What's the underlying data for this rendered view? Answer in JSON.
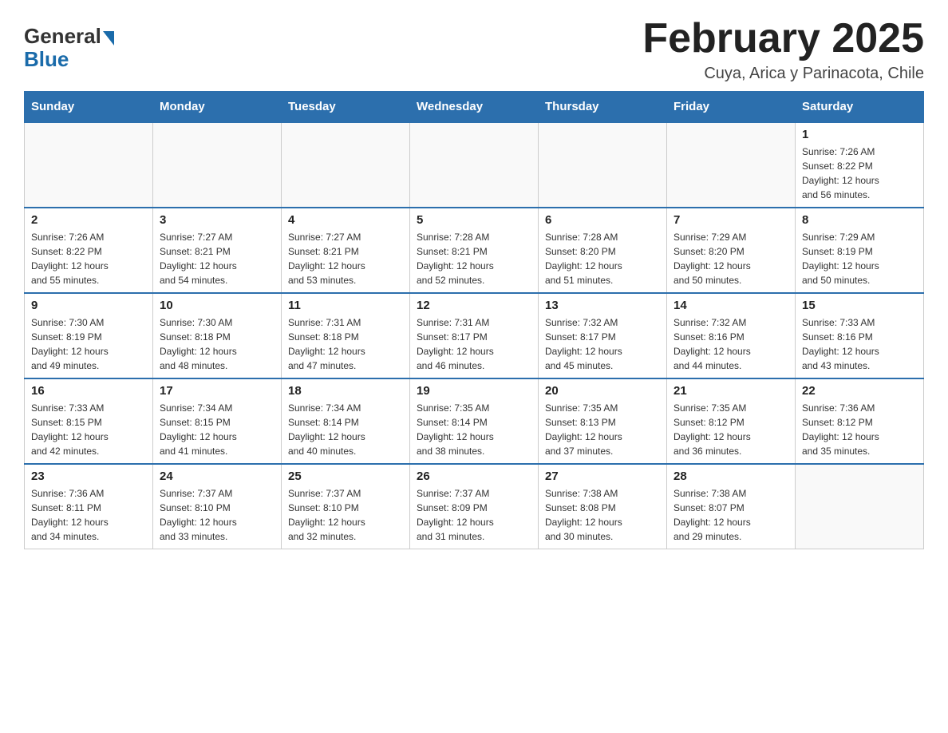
{
  "logo": {
    "general": "General",
    "blue": "Blue"
  },
  "title": "February 2025",
  "subtitle": "Cuya, Arica y Parinacota, Chile",
  "days_header": [
    "Sunday",
    "Monday",
    "Tuesday",
    "Wednesday",
    "Thursday",
    "Friday",
    "Saturday"
  ],
  "weeks": [
    [
      {
        "day": "",
        "info": ""
      },
      {
        "day": "",
        "info": ""
      },
      {
        "day": "",
        "info": ""
      },
      {
        "day": "",
        "info": ""
      },
      {
        "day": "",
        "info": ""
      },
      {
        "day": "",
        "info": ""
      },
      {
        "day": "1",
        "info": "Sunrise: 7:26 AM\nSunset: 8:22 PM\nDaylight: 12 hours\nand 56 minutes."
      }
    ],
    [
      {
        "day": "2",
        "info": "Sunrise: 7:26 AM\nSunset: 8:22 PM\nDaylight: 12 hours\nand 55 minutes."
      },
      {
        "day": "3",
        "info": "Sunrise: 7:27 AM\nSunset: 8:21 PM\nDaylight: 12 hours\nand 54 minutes."
      },
      {
        "day": "4",
        "info": "Sunrise: 7:27 AM\nSunset: 8:21 PM\nDaylight: 12 hours\nand 53 minutes."
      },
      {
        "day": "5",
        "info": "Sunrise: 7:28 AM\nSunset: 8:21 PM\nDaylight: 12 hours\nand 52 minutes."
      },
      {
        "day": "6",
        "info": "Sunrise: 7:28 AM\nSunset: 8:20 PM\nDaylight: 12 hours\nand 51 minutes."
      },
      {
        "day": "7",
        "info": "Sunrise: 7:29 AM\nSunset: 8:20 PM\nDaylight: 12 hours\nand 50 minutes."
      },
      {
        "day": "8",
        "info": "Sunrise: 7:29 AM\nSunset: 8:19 PM\nDaylight: 12 hours\nand 50 minutes."
      }
    ],
    [
      {
        "day": "9",
        "info": "Sunrise: 7:30 AM\nSunset: 8:19 PM\nDaylight: 12 hours\nand 49 minutes."
      },
      {
        "day": "10",
        "info": "Sunrise: 7:30 AM\nSunset: 8:18 PM\nDaylight: 12 hours\nand 48 minutes."
      },
      {
        "day": "11",
        "info": "Sunrise: 7:31 AM\nSunset: 8:18 PM\nDaylight: 12 hours\nand 47 minutes."
      },
      {
        "day": "12",
        "info": "Sunrise: 7:31 AM\nSunset: 8:17 PM\nDaylight: 12 hours\nand 46 minutes."
      },
      {
        "day": "13",
        "info": "Sunrise: 7:32 AM\nSunset: 8:17 PM\nDaylight: 12 hours\nand 45 minutes."
      },
      {
        "day": "14",
        "info": "Sunrise: 7:32 AM\nSunset: 8:16 PM\nDaylight: 12 hours\nand 44 minutes."
      },
      {
        "day": "15",
        "info": "Sunrise: 7:33 AM\nSunset: 8:16 PM\nDaylight: 12 hours\nand 43 minutes."
      }
    ],
    [
      {
        "day": "16",
        "info": "Sunrise: 7:33 AM\nSunset: 8:15 PM\nDaylight: 12 hours\nand 42 minutes."
      },
      {
        "day": "17",
        "info": "Sunrise: 7:34 AM\nSunset: 8:15 PM\nDaylight: 12 hours\nand 41 minutes."
      },
      {
        "day": "18",
        "info": "Sunrise: 7:34 AM\nSunset: 8:14 PM\nDaylight: 12 hours\nand 40 minutes."
      },
      {
        "day": "19",
        "info": "Sunrise: 7:35 AM\nSunset: 8:14 PM\nDaylight: 12 hours\nand 38 minutes."
      },
      {
        "day": "20",
        "info": "Sunrise: 7:35 AM\nSunset: 8:13 PM\nDaylight: 12 hours\nand 37 minutes."
      },
      {
        "day": "21",
        "info": "Sunrise: 7:35 AM\nSunset: 8:12 PM\nDaylight: 12 hours\nand 36 minutes."
      },
      {
        "day": "22",
        "info": "Sunrise: 7:36 AM\nSunset: 8:12 PM\nDaylight: 12 hours\nand 35 minutes."
      }
    ],
    [
      {
        "day": "23",
        "info": "Sunrise: 7:36 AM\nSunset: 8:11 PM\nDaylight: 12 hours\nand 34 minutes."
      },
      {
        "day": "24",
        "info": "Sunrise: 7:37 AM\nSunset: 8:10 PM\nDaylight: 12 hours\nand 33 minutes."
      },
      {
        "day": "25",
        "info": "Sunrise: 7:37 AM\nSunset: 8:10 PM\nDaylight: 12 hours\nand 32 minutes."
      },
      {
        "day": "26",
        "info": "Sunrise: 7:37 AM\nSunset: 8:09 PM\nDaylight: 12 hours\nand 31 minutes."
      },
      {
        "day": "27",
        "info": "Sunrise: 7:38 AM\nSunset: 8:08 PM\nDaylight: 12 hours\nand 30 minutes."
      },
      {
        "day": "28",
        "info": "Sunrise: 7:38 AM\nSunset: 8:07 PM\nDaylight: 12 hours\nand 29 minutes."
      },
      {
        "day": "",
        "info": ""
      }
    ]
  ]
}
